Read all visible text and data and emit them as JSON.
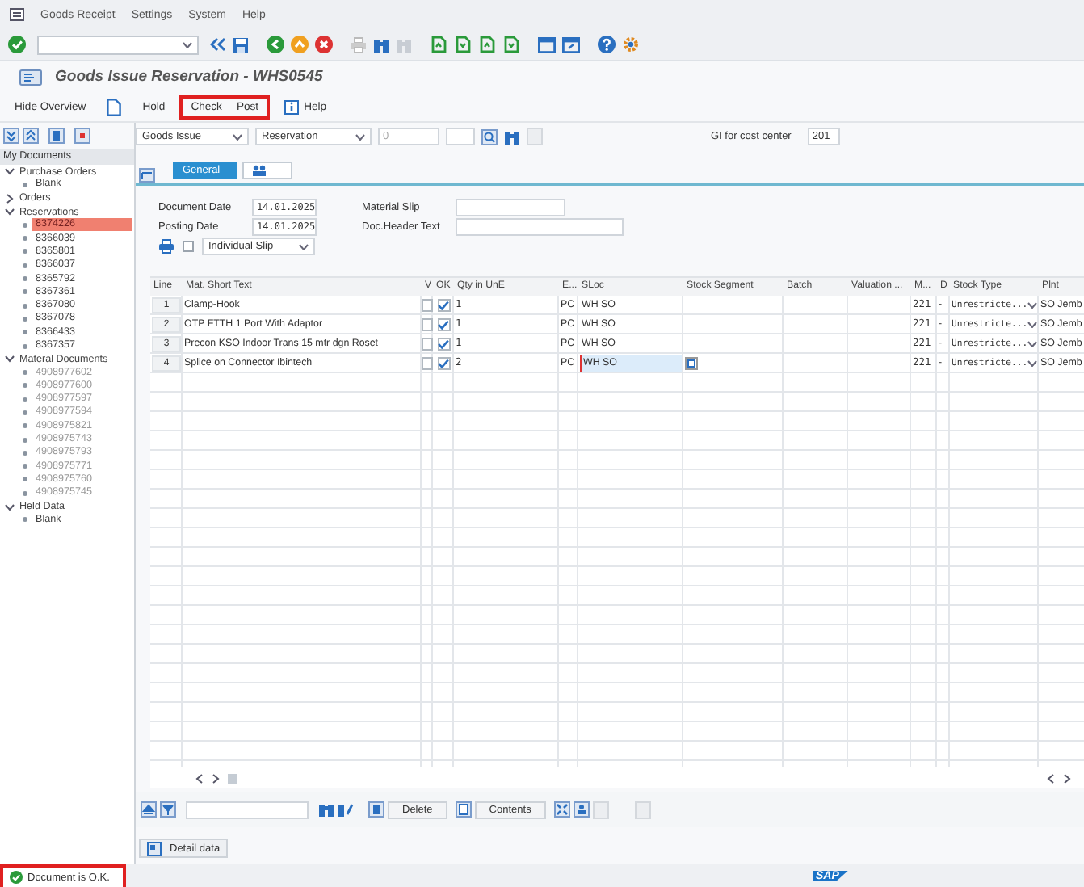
{
  "menu": [
    {
      "label": "Goods Receipt"
    },
    {
      "label": "Settings"
    },
    {
      "label": "System"
    },
    {
      "label": "Help"
    }
  ],
  "title": "Goods Issue Reservation - WHS0545",
  "app_toolbar": [
    {
      "kind": "text",
      "label": "Hide Overview",
      "highlighted": false
    },
    {
      "kind": "icon",
      "highlighted": false
    },
    {
      "kind": "text",
      "label": "Hold",
      "highlighted": false
    },
    {
      "kind": "text",
      "label": "Check",
      "highlighted": true
    },
    {
      "kind": "text",
      "label": "Post",
      "highlighted": true
    },
    {
      "kind": "icon-text",
      "label": "Help",
      "highlighted": false
    }
  ],
  "tree": {
    "header": "My Documents",
    "nodes": [
      {
        "label": "Purchase Orders",
        "expanded": true,
        "children": [
          {
            "label": "Blank",
            "selected": false,
            "disabled": false
          }
        ]
      },
      {
        "label": "Orders",
        "expanded": false
      },
      {
        "label": "Reservations",
        "expanded": true,
        "children": [
          {
            "label": "8374226",
            "selected": true,
            "disabled": false
          },
          {
            "label": "8366039",
            "selected": false,
            "disabled": false
          },
          {
            "label": "8365801",
            "selected": false,
            "disabled": false
          },
          {
            "label": "8366037",
            "selected": false,
            "disabled": false
          },
          {
            "label": "8365792",
            "selected": false,
            "disabled": false
          },
          {
            "label": "8367361",
            "selected": false,
            "disabled": false
          },
          {
            "label": "8367080",
            "selected": false,
            "disabled": false
          },
          {
            "label": "8367078",
            "selected": false,
            "disabled": false
          },
          {
            "label": "8366433",
            "selected": false,
            "disabled": false
          },
          {
            "label": "8367357",
            "selected": false,
            "disabled": false
          }
        ]
      },
      {
        "label": "Materal Documents",
        "expanded": true,
        "children": [
          {
            "label": "4908977602",
            "selected": false,
            "disabled": true
          },
          {
            "label": "4908977600",
            "selected": false,
            "disabled": true
          },
          {
            "label": "4908977597",
            "selected": false,
            "disabled": true
          },
          {
            "label": "4908977594",
            "selected": false,
            "disabled": true
          },
          {
            "label": "4908975821",
            "selected": false,
            "disabled": true
          },
          {
            "label": "4908975743",
            "selected": false,
            "disabled": true
          },
          {
            "label": "4908975793",
            "selected": false,
            "disabled": true
          },
          {
            "label": "4908975771",
            "selected": false,
            "disabled": true
          },
          {
            "label": "4908975760",
            "selected": false,
            "disabled": true
          },
          {
            "label": "4908975745",
            "selected": false,
            "disabled": true
          }
        ]
      },
      {
        "label": "Held Data",
        "expanded": true,
        "children": [
          {
            "label": "Blank",
            "selected": false,
            "disabled": false
          }
        ]
      }
    ]
  },
  "selection": {
    "transaction": "Goods Issue",
    "reference": "Reservation",
    "number": "0",
    "cost_center_label": "GI for cost center",
    "cost_center": "201"
  },
  "tabs": [
    {
      "kind": "text",
      "label": "General",
      "selected": true
    },
    {
      "kind": "icon",
      "selected": false
    }
  ],
  "header": {
    "document_date_label": "Document Date",
    "document_date": "14.01.2025",
    "posting_date_label": "Posting Date",
    "posting_date": "14.01.2025",
    "material_slip_label": "Material Slip",
    "header_text_label": "Doc.Header Text",
    "print": {
      "checked": false
    },
    "print_version": "Individual Slip"
  },
  "table": {
    "columns": [
      "Line",
      "Mat. Short Text",
      "V",
      "OK",
      "Qty in UnE",
      "E...",
      "SLoc",
      "Stock Segment",
      "Batch",
      "Valuation ...",
      "M...",
      "D",
      "Stock Type",
      "Plnt"
    ],
    "rows": [
      {
        "line": "1",
        "text": "Clamp-Hook",
        "v": false,
        "ok": true,
        "qty": "1",
        "unit": "PC",
        "sloc": "WH SO",
        "movement": "221",
        "d": "-",
        "stock_type": "Unrestricte...",
        "plant": "SO Jemb",
        "editing": false
      },
      {
        "line": "2",
        "text": "OTP FTTH 1 Port With Adaptor",
        "v": false,
        "ok": true,
        "qty": "1",
        "unit": "PC",
        "sloc": "WH SO",
        "movement": "221",
        "d": "-",
        "stock_type": "Unrestricte...",
        "plant": "SO Jemb",
        "editing": false
      },
      {
        "line": "3",
        "text": "Precon KSO Indoor Trans 15 mtr dgn Roset",
        "v": false,
        "ok": true,
        "qty": "1",
        "unit": "PC",
        "sloc": "WH SO",
        "movement": "221",
        "d": "-",
        "stock_type": "Unrestricte...",
        "plant": "SO Jemb",
        "editing": false
      },
      {
        "line": "4",
        "text": "Splice on Connector Ibintech",
        "v": false,
        "ok": true,
        "qty": "2",
        "unit": "PC",
        "sloc": "WH SO",
        "movement": "221",
        "d": "-",
        "stock_type": "Unrestricte...",
        "plant": "SO Jemb",
        "editing": true
      }
    ]
  },
  "bottom_toolbar": {
    "buttons": [
      {
        "label": "Delete"
      },
      {
        "label": "Contents"
      }
    ]
  },
  "detail_tab": {
    "label": "Detail data"
  },
  "status_bar": {
    "message": "Document is O.K.",
    "highlighted": true,
    "logo": "SAP"
  }
}
